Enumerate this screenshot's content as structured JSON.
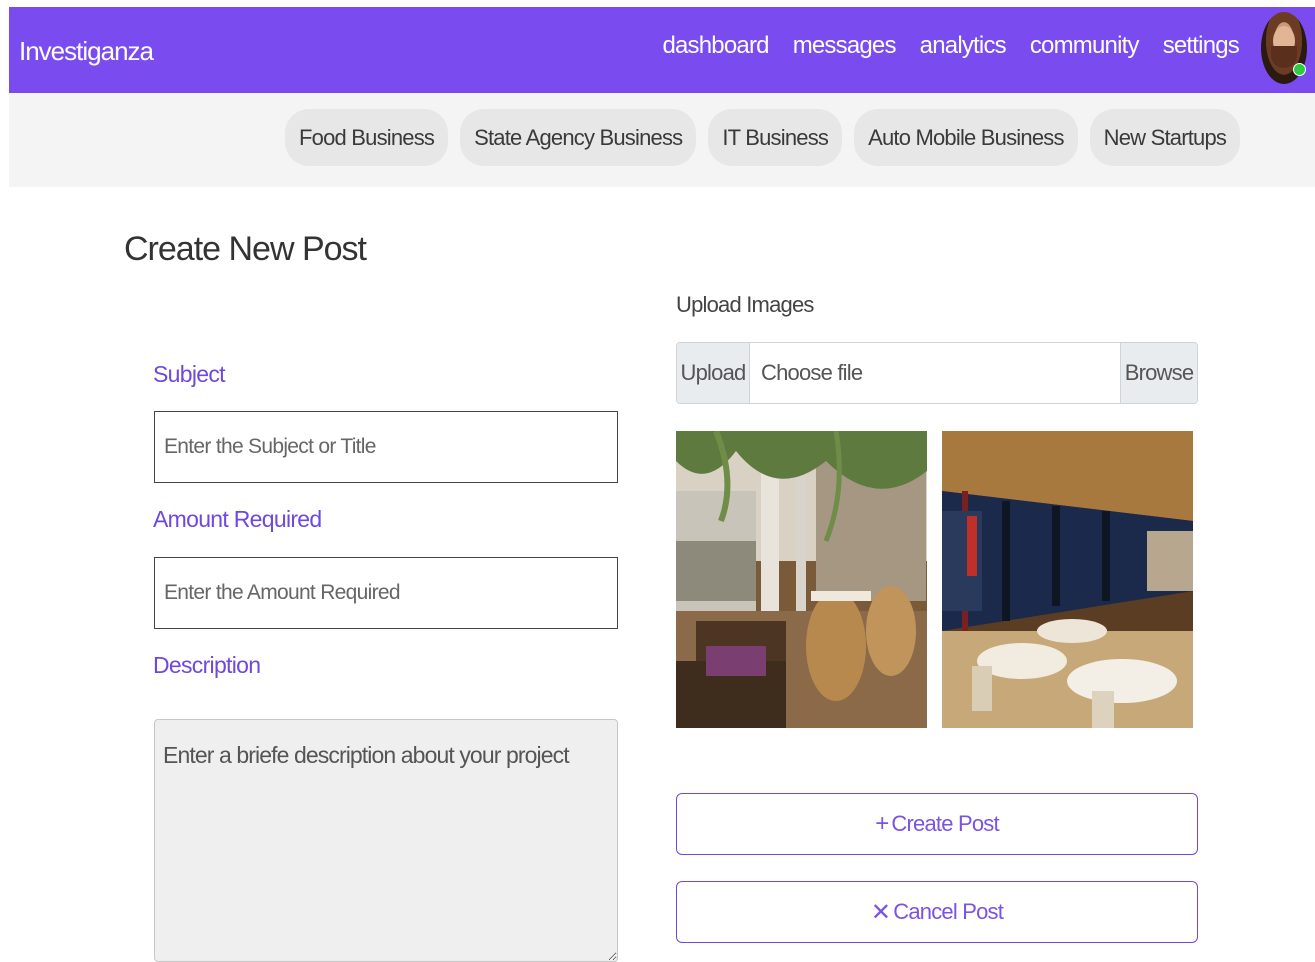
{
  "navbar": {
    "brand": "Investiganza",
    "links": [
      "dashboard",
      "messages",
      "analytics",
      "community",
      "settings"
    ]
  },
  "categories": [
    "Food Business",
    "State Agency Business",
    "IT Business",
    "Auto Mobile Business",
    "New Startups"
  ],
  "form": {
    "title": "Create New Post",
    "subject": {
      "label": "Subject",
      "placeholder": "Enter the Subject or Title"
    },
    "amount": {
      "label": "Amount Required",
      "placeholder": "Enter the Amount Required"
    },
    "description": {
      "label": "Description",
      "placeholder": "Enter a briefe description about your project"
    }
  },
  "upload": {
    "label": "Upload Images",
    "prefix": "Upload",
    "choose": "Choose file",
    "browse": "Browse"
  },
  "actions": {
    "create_icon": "+",
    "create_label": "Create Post",
    "cancel_icon": "✕",
    "cancel_label": "Cancel Post"
  },
  "colors": {
    "accent": "#7a4cf0",
    "label": "#6f48e0"
  },
  "icons": [
    "plus-icon",
    "close-icon"
  ]
}
